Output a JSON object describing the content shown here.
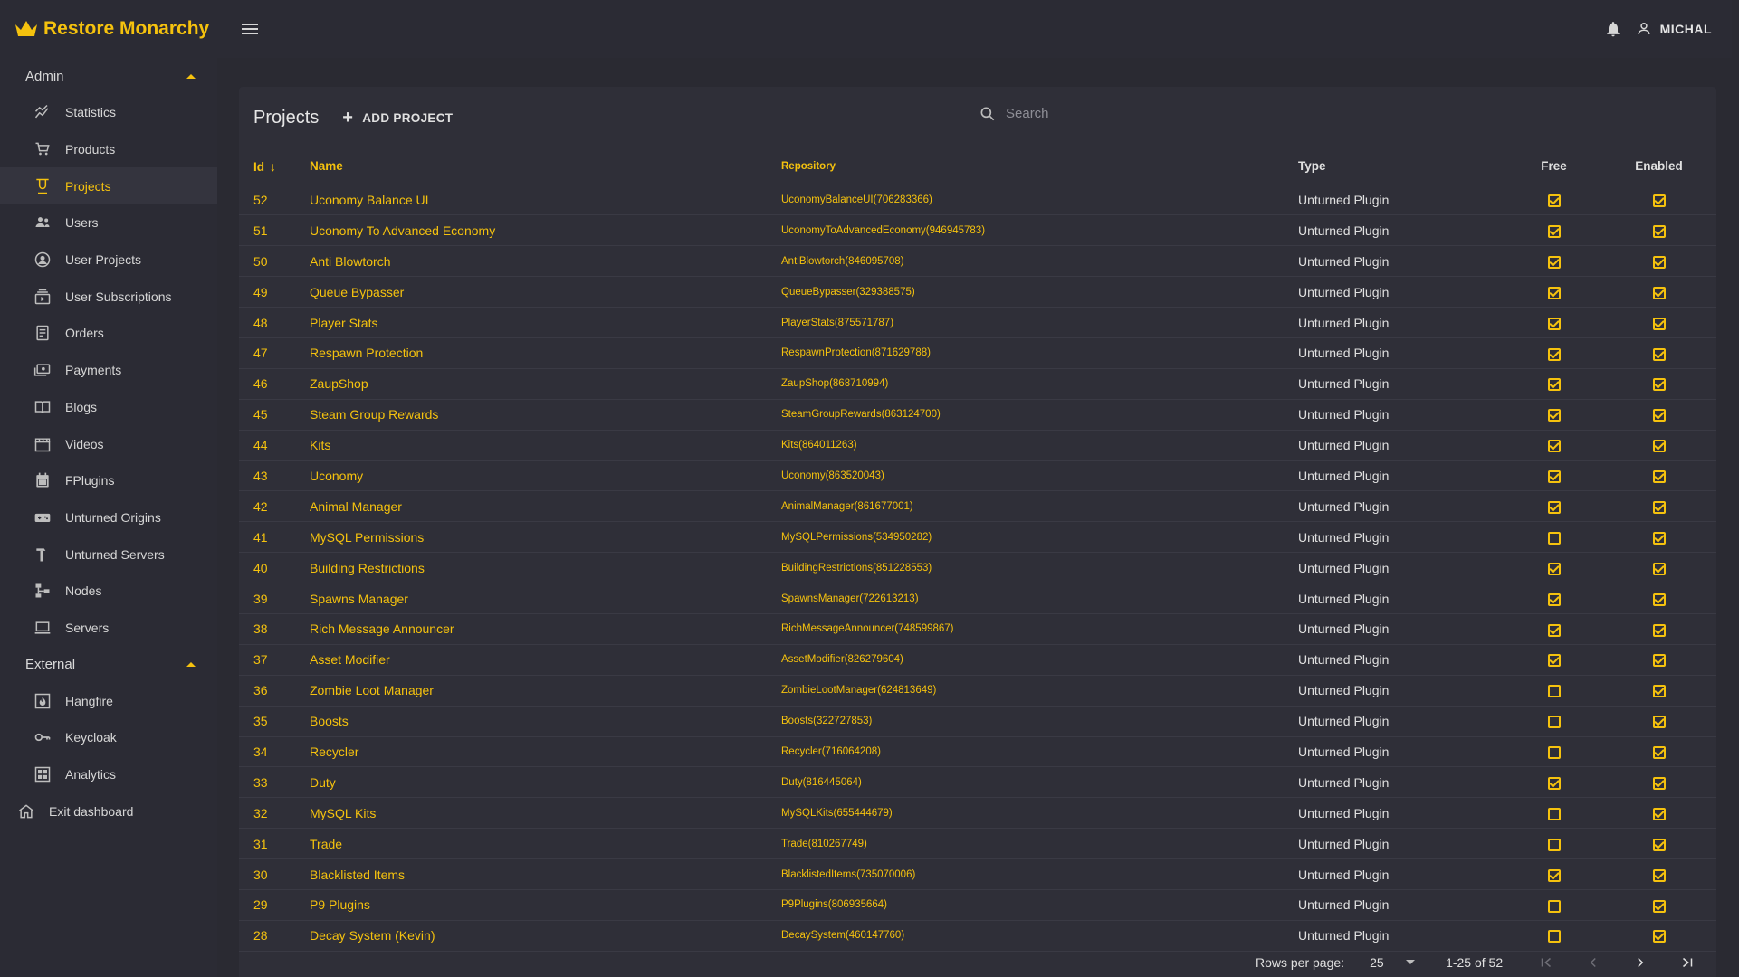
{
  "brand": {
    "title": "Restore Monarchy",
    "color": "#f5c20e"
  },
  "sidebar": {
    "sections": [
      {
        "label": "Admin",
        "items": [
          {
            "label": "Statistics",
            "icon": "chart-icon"
          },
          {
            "label": "Products",
            "icon": "cart-icon"
          },
          {
            "label": "Projects",
            "icon": "flask-icon",
            "active": true
          },
          {
            "label": "Users",
            "icon": "users-icon"
          },
          {
            "label": "User Projects",
            "icon": "globe-user-icon"
          },
          {
            "label": "User Subscriptions",
            "icon": "subscriptions-icon"
          },
          {
            "label": "Orders",
            "icon": "receipt-icon"
          },
          {
            "label": "Payments",
            "icon": "payments-icon"
          },
          {
            "label": "Blogs",
            "icon": "book-icon"
          },
          {
            "label": "Videos",
            "icon": "clapper-icon"
          },
          {
            "label": "FPlugins",
            "icon": "calendar-icon"
          },
          {
            "label": "Unturned Origins",
            "icon": "gamepad-icon"
          },
          {
            "label": "Unturned Servers",
            "icon": "hammer-icon"
          },
          {
            "label": "Nodes",
            "icon": "nodes-icon"
          },
          {
            "label": "Servers",
            "icon": "laptop-icon"
          }
        ]
      },
      {
        "label": "External",
        "items": [
          {
            "label": "Hangfire",
            "icon": "fire-icon"
          },
          {
            "label": "Keycloak",
            "icon": "key-icon"
          },
          {
            "label": "Analytics",
            "icon": "grid-icon"
          }
        ]
      }
    ],
    "exit": {
      "label": "Exit dashboard",
      "icon": "home-icon"
    }
  },
  "topbar": {
    "user": "MICHAL"
  },
  "projects": {
    "title": "Projects",
    "add_label": "ADD PROJECT",
    "search_placeholder": "Search",
    "columns": {
      "id": "Id",
      "name": "Name",
      "repository": "Repository",
      "type": "Type",
      "free": "Free",
      "enabled": "Enabled"
    },
    "rows": [
      {
        "id": "52",
        "name": "Uconomy Balance UI",
        "repo": "UconomyBalanceUI(706283366)",
        "type": "Unturned Plugin",
        "free": true,
        "enabled": true
      },
      {
        "id": "51",
        "name": "Uconomy To Advanced Economy",
        "repo": "UconomyToAdvancedEconomy(946945783)",
        "type": "Unturned Plugin",
        "free": true,
        "enabled": true
      },
      {
        "id": "50",
        "name": "Anti Blowtorch",
        "repo": "AntiBlowtorch(846095708)",
        "type": "Unturned Plugin",
        "free": true,
        "enabled": true
      },
      {
        "id": "49",
        "name": "Queue Bypasser",
        "repo": "QueueBypasser(329388575)",
        "type": "Unturned Plugin",
        "free": true,
        "enabled": true
      },
      {
        "id": "48",
        "name": "Player Stats",
        "repo": "PlayerStats(875571787)",
        "type": "Unturned Plugin",
        "free": true,
        "enabled": true
      },
      {
        "id": "47",
        "name": "Respawn Protection",
        "repo": "RespawnProtection(871629788)",
        "type": "Unturned Plugin",
        "free": true,
        "enabled": true
      },
      {
        "id": "46",
        "name": "ZaupShop",
        "repo": "ZaupShop(868710994)",
        "type": "Unturned Plugin",
        "free": true,
        "enabled": true
      },
      {
        "id": "45",
        "name": "Steam Group Rewards",
        "repo": "SteamGroupRewards(863124700)",
        "type": "Unturned Plugin",
        "free": true,
        "enabled": true
      },
      {
        "id": "44",
        "name": "Kits",
        "repo": "Kits(864011263)",
        "type": "Unturned Plugin",
        "free": true,
        "enabled": true
      },
      {
        "id": "43",
        "name": "Uconomy",
        "repo": "Uconomy(863520043)",
        "type": "Unturned Plugin",
        "free": true,
        "enabled": true
      },
      {
        "id": "42",
        "name": "Animal Manager",
        "repo": "AnimalManager(861677001)",
        "type": "Unturned Plugin",
        "free": true,
        "enabled": true
      },
      {
        "id": "41",
        "name": "MySQL Permissions",
        "repo": "MySQLPermissions(534950282)",
        "type": "Unturned Plugin",
        "free": false,
        "enabled": true
      },
      {
        "id": "40",
        "name": "Building Restrictions",
        "repo": "BuildingRestrictions(851228553)",
        "type": "Unturned Plugin",
        "free": true,
        "enabled": true
      },
      {
        "id": "39",
        "name": "Spawns Manager",
        "repo": "SpawnsManager(722613213)",
        "type": "Unturned Plugin",
        "free": true,
        "enabled": true
      },
      {
        "id": "38",
        "name": "Rich Message Announcer",
        "repo": "RichMessageAnnouncer(748599867)",
        "type": "Unturned Plugin",
        "free": true,
        "enabled": true
      },
      {
        "id": "37",
        "name": "Asset Modifier",
        "repo": "AssetModifier(826279604)",
        "type": "Unturned Plugin",
        "free": true,
        "enabled": true
      },
      {
        "id": "36",
        "name": "Zombie Loot Manager",
        "repo": "ZombieLootManager(624813649)",
        "type": "Unturned Plugin",
        "free": false,
        "enabled": true
      },
      {
        "id": "35",
        "name": "Boosts",
        "repo": "Boosts(322727853)",
        "type": "Unturned Plugin",
        "free": false,
        "enabled": true
      },
      {
        "id": "34",
        "name": "Recycler",
        "repo": "Recycler(716064208)",
        "type": "Unturned Plugin",
        "free": false,
        "enabled": true
      },
      {
        "id": "33",
        "name": "Duty",
        "repo": "Duty(816445064)",
        "type": "Unturned Plugin",
        "free": true,
        "enabled": true
      },
      {
        "id": "32",
        "name": "MySQL Kits",
        "repo": "MySQLKits(655444679)",
        "type": "Unturned Plugin",
        "free": false,
        "enabled": true
      },
      {
        "id": "31",
        "name": "Trade",
        "repo": "Trade(810267749)",
        "type": "Unturned Plugin",
        "free": false,
        "enabled": true
      },
      {
        "id": "30",
        "name": "Blacklisted Items",
        "repo": "BlacklistedItems(735070006)",
        "type": "Unturned Plugin",
        "free": true,
        "enabled": true
      },
      {
        "id": "29",
        "name": "P9 Plugins",
        "repo": "P9Plugins(806935664)",
        "type": "Unturned Plugin",
        "free": false,
        "enabled": true
      },
      {
        "id": "28",
        "name": "Decay System (Kevin)",
        "repo": "DecaySystem(460147760)",
        "type": "Unturned Plugin",
        "free": false,
        "enabled": true
      }
    ],
    "pagination": {
      "rows_per_page_label": "Rows per page:",
      "rows_per_page": "25",
      "range": "1-25 of 52"
    }
  }
}
